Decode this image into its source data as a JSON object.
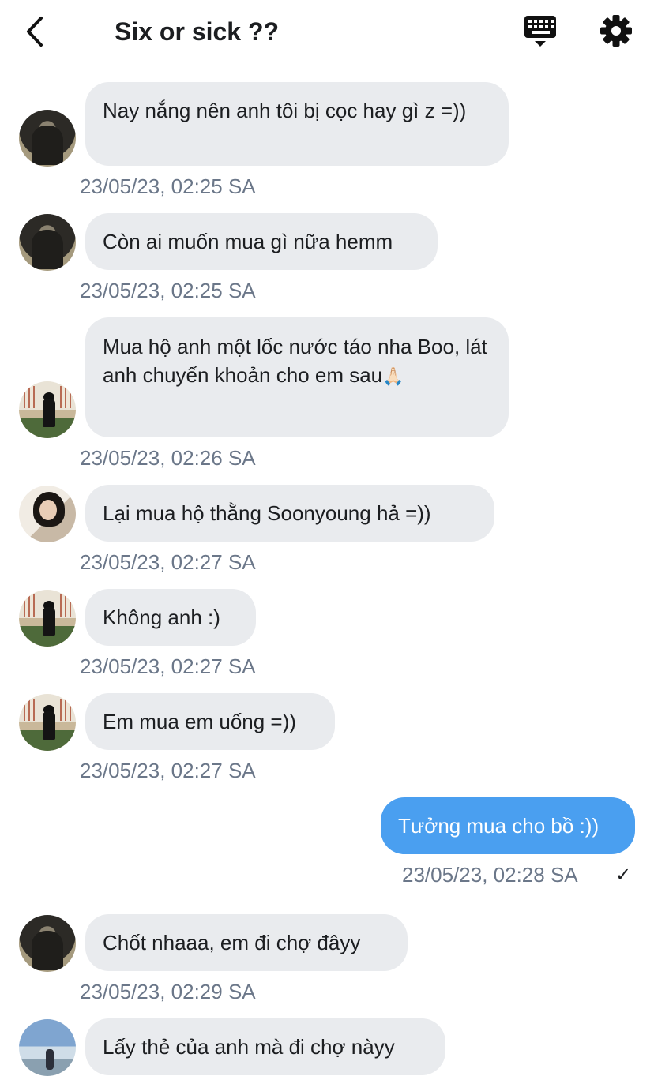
{
  "header": {
    "title": "Six or sick ??",
    "back_icon": "chevron-left-icon",
    "keyboard_icon": "keyboard-icon",
    "settings_icon": "gear-icon"
  },
  "colors": {
    "incoming_bubble": "#e9ebee",
    "outgoing_bubble": "#4a9ff0",
    "timestamp": "#6b7789"
  },
  "messages": [
    {
      "text": "Nay nắng nên anh tôi bị cọc hay gì z =))",
      "time": "23/05/23, 02:25 SA"
    },
    {
      "text": "Còn ai muốn mua gì nữa hemm",
      "time": "23/05/23, 02:25 SA"
    },
    {
      "text": "Mua hộ anh một lốc nước táo nha Boo, lát anh chuyển khoản cho em sau",
      "emoji": "🙏🏻",
      "time": "23/05/23, 02:26 SA"
    },
    {
      "text": "Lại mua hộ thằng Soonyoung hả =))",
      "time": "23/05/23, 02:27 SA"
    },
    {
      "text": "Không anh :)",
      "time": "23/05/23, 02:27 SA"
    },
    {
      "text": "Em mua em uống =))",
      "time": "23/05/23, 02:27 SA"
    },
    {
      "text": "Tưởng mua cho bồ :))",
      "time": "23/05/23, 02:28 SA",
      "status": "✓"
    },
    {
      "text": "Chốt nhaaa, em đi chợ đâyy",
      "time": "23/05/23, 02:29 SA"
    },
    {
      "text": "Lấy thẻ của anh mà đi chợ nàyy"
    }
  ]
}
